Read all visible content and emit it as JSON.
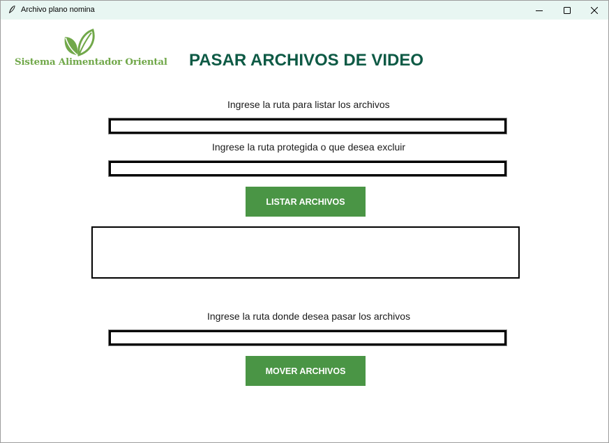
{
  "window": {
    "title": "Archivo plano nomina",
    "icon": "feather-icon",
    "controls": [
      "minimize-icon",
      "maximize-icon",
      "close-icon"
    ]
  },
  "logo": {
    "text": "Sistema Alimentador Oriental",
    "icon": "leaf-icon",
    "color": "#71a84a"
  },
  "header": {
    "title": "PASAR ARCHIVOS DE VIDEO",
    "color": "#0e5a45"
  },
  "form": {
    "list_path_label": "Ingrese la ruta para listar los archivos",
    "list_path_value": "",
    "exclude_path_label": "Ingrese la ruta protegida o que desea excluir",
    "exclude_path_value": "",
    "list_button_label": "LISTAR ARCHIVOS",
    "file_list": [],
    "destination_label": "Ingrese la ruta donde desea pasar los archivos",
    "destination_value": "",
    "move_button_label": "MOVER ARCHIVOS",
    "button_color": "#4a9545"
  }
}
